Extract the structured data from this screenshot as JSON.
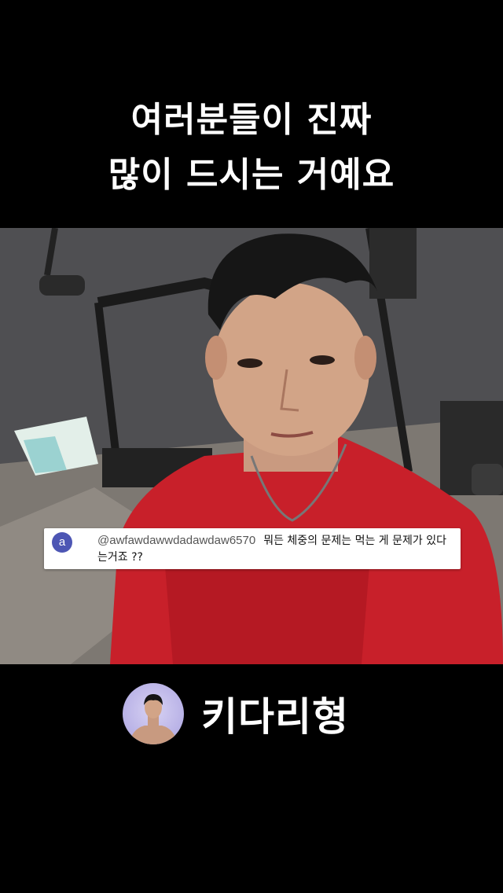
{
  "caption": {
    "line1": "여러분들이 진짜",
    "line2": "많이 드시는 거예요"
  },
  "comment": {
    "avatar_letter": "a",
    "username": "@awfawdawwdadawdaw6570",
    "text": "뭐든 체중의 문제는 먹는 게 문제가 있다는거죠 ??"
  },
  "channel": {
    "name": "키다리형"
  },
  "colors": {
    "background": "#000000",
    "comment_avatar": "#4d56b4",
    "shirt": "#c8202a"
  }
}
